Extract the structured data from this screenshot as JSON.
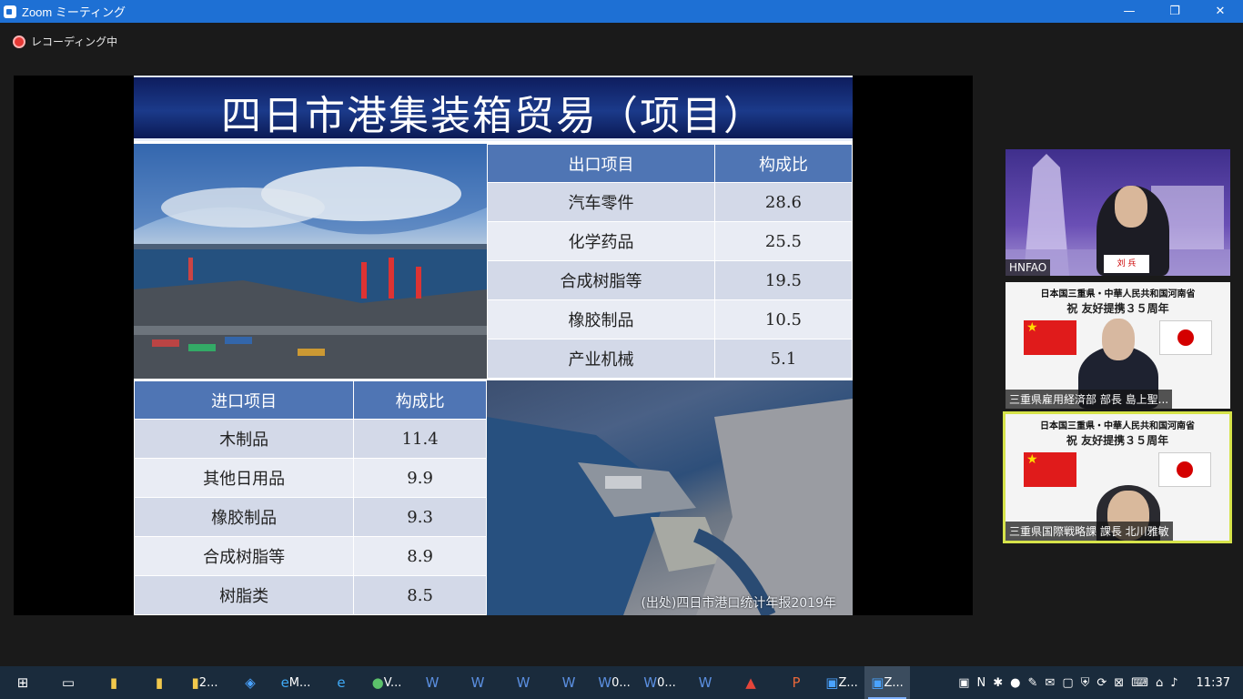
{
  "window": {
    "title": "Zoom ミーティング",
    "controls": [
      "—",
      "❐",
      "✕"
    ]
  },
  "recording": {
    "label": "レコーディング中"
  },
  "slide": {
    "title": "四日市港集装箱贸易（项目）",
    "export_table": {
      "headers": [
        "出口项目",
        "构成比"
      ],
      "rows": [
        [
          "汽车零件",
          "28.6"
        ],
        [
          "化学药品",
          "25.5"
        ],
        [
          "合成树脂等",
          "19.5"
        ],
        [
          "橡胶制品",
          "10.5"
        ],
        [
          "产业机械",
          "5.1"
        ]
      ]
    },
    "import_table": {
      "headers": [
        "进口项目",
        "构成比"
      ],
      "rows": [
        [
          "木制品",
          "11.4"
        ],
        [
          "其他日用品",
          "9.9"
        ],
        [
          "橡胶制品",
          "9.3"
        ],
        [
          "合成树脂等",
          "8.9"
        ],
        [
          "树脂类",
          "8.5"
        ]
      ]
    },
    "source": "(出处)四日市港口统计年报2019年"
  },
  "participants": [
    {
      "name": "HNFAO",
      "nameplate": "刘 兵"
    },
    {
      "name": "三重県雇用経済部 部長 島上聖...",
      "banner": "日本国三重県・中華人民共和国河南省",
      "banner2": "祝 友好提携３５周年"
    },
    {
      "name": "三重県国際戦略課 課長 北川雅敏",
      "banner": "日本国三重県・中華人民共和国河南省",
      "banner2": "祝 友好提携３５周年"
    }
  ],
  "taskbar": {
    "items": [
      {
        "icon": "folder-icon",
        "label": ""
      },
      {
        "icon": "folder-icon",
        "label": ""
      },
      {
        "icon": "folder-icon",
        "label": "2..."
      },
      {
        "icon": "outlook-icon",
        "label": ""
      },
      {
        "icon": "ie-icon",
        "label": "M..."
      },
      {
        "icon": "ie-icon",
        "label": ""
      },
      {
        "icon": "wechat-icon",
        "label": "V..."
      },
      {
        "icon": "word-icon",
        "label": ""
      },
      {
        "icon": "word-icon",
        "label": ""
      },
      {
        "icon": "word-icon",
        "label": ""
      },
      {
        "icon": "word-icon",
        "label": ""
      },
      {
        "icon": "word-icon",
        "label": "0..."
      },
      {
        "icon": "word-icon",
        "label": "0..."
      },
      {
        "icon": "word-icon",
        "label": ""
      },
      {
        "icon": "pdf-icon",
        "label": ""
      },
      {
        "icon": "powerpoint-icon",
        "label": ""
      },
      {
        "icon": "zoom-icon",
        "label": "Z..."
      },
      {
        "icon": "zoom-icon",
        "label": "Z..."
      }
    ],
    "clock": "11:37"
  }
}
